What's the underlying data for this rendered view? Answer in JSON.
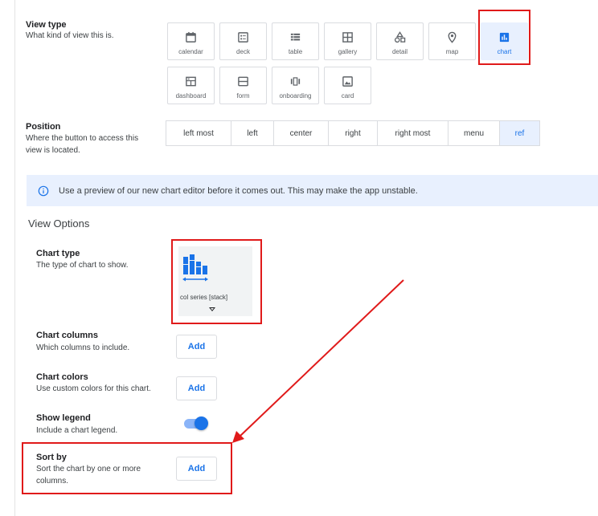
{
  "view_type": {
    "title": "View type",
    "description": "What kind of view this is.",
    "options": [
      {
        "label": "calendar",
        "icon": "calendar-icon"
      },
      {
        "label": "deck",
        "icon": "deck-icon"
      },
      {
        "label": "table",
        "icon": "table-icon"
      },
      {
        "label": "gallery",
        "icon": "gallery-icon"
      },
      {
        "label": "detail",
        "icon": "detail-icon"
      },
      {
        "label": "map",
        "icon": "map-pin-icon"
      },
      {
        "label": "chart",
        "icon": "chart-icon",
        "selected": true
      },
      {
        "label": "dashboard",
        "icon": "dashboard-icon"
      },
      {
        "label": "form",
        "icon": "form-icon"
      },
      {
        "label": "onboarding",
        "icon": "onboarding-icon"
      },
      {
        "label": "card",
        "icon": "card-icon"
      }
    ]
  },
  "position": {
    "title": "Position",
    "description_line1": "Where the button to access this",
    "description_line2": "view is located.",
    "options": [
      "left most",
      "left",
      "center",
      "right",
      "right most",
      "menu",
      "ref"
    ],
    "selected": "ref"
  },
  "banner": {
    "icon": "info-icon",
    "text": "Use a preview of our new chart editor before it comes out. This may make the app unstable."
  },
  "view_options": {
    "title": "View Options",
    "chart_type": {
      "title": "Chart type",
      "description": "The type of chart to show.",
      "value": "col series [stack]"
    },
    "chart_columns": {
      "title": "Chart columns",
      "description": "Which columns to include.",
      "button": "Add"
    },
    "chart_colors": {
      "title": "Chart colors",
      "description": "Use custom colors for this chart.",
      "button": "Add"
    },
    "show_legend": {
      "title": "Show legend",
      "description": "Include a chart legend.",
      "enabled": true
    },
    "sort_by": {
      "title": "Sort by",
      "description_line1": "Sort the chart by one or more",
      "description_line2": "columns.",
      "button": "Add"
    }
  },
  "colors": {
    "accent": "#1a73e8",
    "selected_bg": "#e8f0fe",
    "annotation": "#e01a1a"
  }
}
